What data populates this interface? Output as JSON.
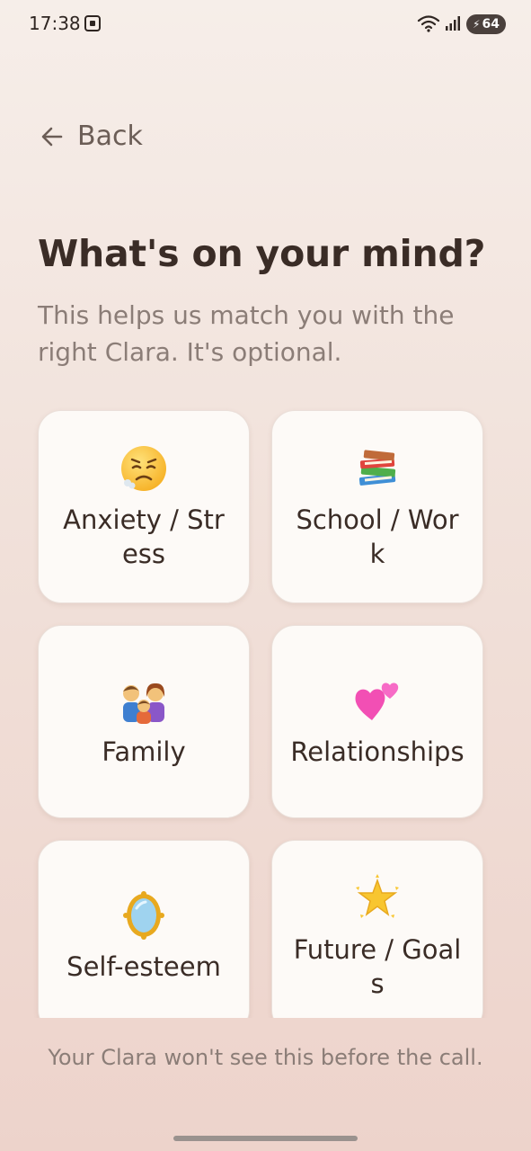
{
  "status_bar": {
    "time": "17:38",
    "battery": "64",
    "icons": [
      "screen-record-icon",
      "wifi-icon",
      "signal-icon",
      "battery-icon"
    ]
  },
  "nav": {
    "back_label": "Back",
    "back_icon": "arrow-left-icon"
  },
  "header": {
    "title": "What's on your mind?",
    "subtitle": "This helps us match you with the right Clara. It's optional."
  },
  "options": [
    {
      "label": "Anxiety / Stress",
      "icon": "anxious-face-icon"
    },
    {
      "label": "School / Work",
      "icon": "books-icon"
    },
    {
      "label": "Family",
      "icon": "family-icon"
    },
    {
      "label": "Relationships",
      "icon": "two-hearts-icon"
    },
    {
      "label": "Self-esteem",
      "icon": "mirror-icon"
    },
    {
      "label": "Future / Goals",
      "icon": "glowing-star-icon"
    }
  ],
  "footer": {
    "note": "Your Clara won't see this before the call."
  },
  "colors": {
    "background_top": "#f6eee9",
    "background_bottom": "#edd3cb",
    "card": "#fdfaf7",
    "title_text": "#3a2c26",
    "muted_text": "#8b7d77"
  }
}
